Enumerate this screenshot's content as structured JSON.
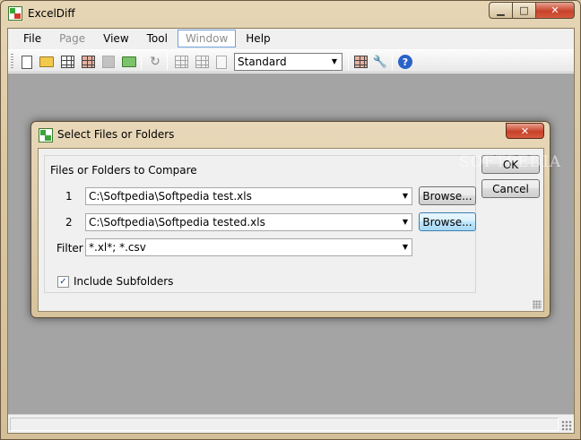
{
  "window": {
    "title": "ExcelDiff",
    "minimize_glyph": "▁",
    "maximize_glyph": "□",
    "close_glyph": "✕"
  },
  "menu": {
    "items": [
      {
        "label": "File",
        "state": "normal"
      },
      {
        "label": "Page",
        "state": "disabled"
      },
      {
        "label": "View",
        "state": "normal"
      },
      {
        "label": "Tool",
        "state": "normal"
      },
      {
        "label": "Window",
        "state": "highlight"
      },
      {
        "label": "Help",
        "state": "normal"
      }
    ]
  },
  "toolbar": {
    "view_combo_value": "Standard",
    "combo_arrow": "▼",
    "help_glyph": "?",
    "refresh_glyph": "↻",
    "tools_glyph": "🔧"
  },
  "dialog": {
    "title": "Select Files or Folders",
    "close_glyph": "✕",
    "group_title": "Files or Folders to Compare",
    "row1_label": "1",
    "row1_value": "C:\\Softpedia\\Softpedia test.xls",
    "row2_label": "2",
    "row2_value": "C:\\Softpedia\\Softpedia tested.xls",
    "browse_label": "Browse...",
    "filter_label": "Filter",
    "filter_value": "*.xl*; *.csv",
    "dropdown_arrow": "▼",
    "include_subfolders_label": "Include Subfolders",
    "include_subfolders_checked": true,
    "check_glyph": "✓",
    "ok_label": "OK",
    "cancel_label": "Cancel"
  },
  "watermark": "SOFTPEDIA",
  "colors": {
    "frame": "#dcc8a2",
    "mdi_background": "#a4a4a4",
    "close_button": "#c7422a",
    "focused_button": "#bee6fd"
  }
}
